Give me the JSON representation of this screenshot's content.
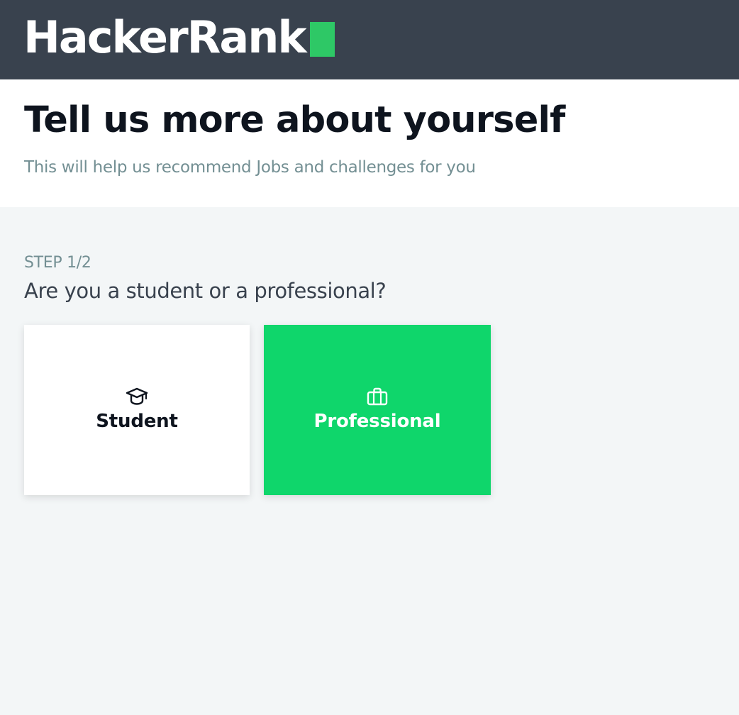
{
  "header": {
    "logo_text": "HackerRank",
    "logo_accent_color": "#2ec866"
  },
  "intro": {
    "title": "Tell us more about yourself",
    "subtitle": "This will help us recommend Jobs and challenges for you"
  },
  "step": {
    "label": "STEP 1/2",
    "question": "Are you a student or a professional?"
  },
  "options": [
    {
      "label": "Student",
      "icon": "graduation-cap-icon",
      "selected": false
    },
    {
      "label": "Professional",
      "icon": "briefcase-icon",
      "selected": true
    }
  ],
  "colors": {
    "topbar": "#39424e",
    "selected_card": "#0fd66b",
    "page_background": "#f3f6f7"
  }
}
